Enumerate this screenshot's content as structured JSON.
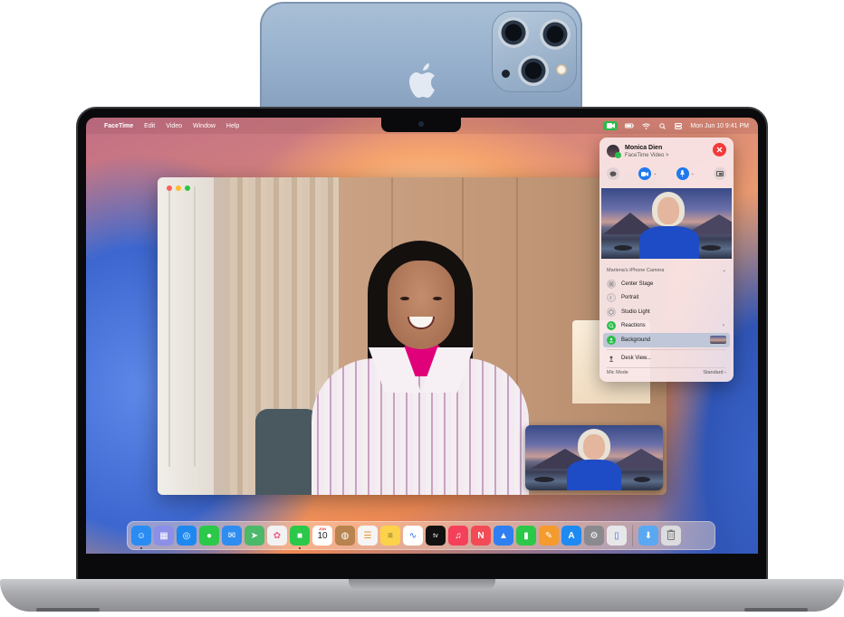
{
  "menubar": {
    "app_name": "FaceTime",
    "menus": [
      "Edit",
      "Video",
      "Window",
      "Help"
    ],
    "datetime": "Mon Jun 10  9:41 PM"
  },
  "control_center": {
    "caller_name": "Monica Dien",
    "caller_subtitle": "FaceTime Video >",
    "camera_section": "Marlena's iPhone Camera",
    "effects": [
      {
        "label": "Center Stage",
        "icon": "center-stage-icon",
        "active": false
      },
      {
        "label": "Portrait",
        "icon": "portrait-icon",
        "active": false
      },
      {
        "label": "Studio Light",
        "icon": "studio-light-icon",
        "active": false
      },
      {
        "label": "Reactions",
        "icon": "reactions-icon",
        "active": true
      },
      {
        "label": "Background",
        "icon": "background-icon",
        "active": true
      }
    ],
    "desk_view": "Desk View...",
    "mic_mode_label": "Mic Mode",
    "mic_mode_value": "Standard"
  },
  "dock": {
    "calendar_month": "JUN",
    "calendar_day": "10",
    "apps": [
      {
        "name": "finder",
        "color": "#2a8cf2",
        "glyph": "☺"
      },
      {
        "name": "launchpad",
        "color": "#8b8fe8",
        "glyph": "▦"
      },
      {
        "name": "safari",
        "color": "#1d88f0",
        "glyph": "◎"
      },
      {
        "name": "messages",
        "color": "#2cc84a",
        "glyph": "●"
      },
      {
        "name": "mail",
        "color": "#2f8cf0",
        "glyph": "✉"
      },
      {
        "name": "maps",
        "color": "#4bb86a",
        "glyph": "➤"
      },
      {
        "name": "photos",
        "color": "#f2f2f2",
        "glyph": "✿"
      },
      {
        "name": "facetime",
        "color": "#2cc84a",
        "glyph": "■"
      }
    ],
    "apps2": [
      {
        "name": "freeform-notes",
        "color": "#b8834f",
        "glyph": "◍"
      },
      {
        "name": "reminders",
        "color": "#f5f5f5",
        "glyph": "☰"
      },
      {
        "name": "notes",
        "color": "#fcd24a",
        "glyph": "≡"
      },
      {
        "name": "freeform",
        "color": "#ffffff",
        "glyph": "∿"
      },
      {
        "name": "apple-tv",
        "color": "#111111",
        "glyph": "tv"
      },
      {
        "name": "music",
        "color": "#f4405a",
        "glyph": "♫"
      },
      {
        "name": "news",
        "color": "#f24b55",
        "glyph": "N"
      },
      {
        "name": "keynote",
        "color": "#2f7ff0",
        "glyph": "▲"
      },
      {
        "name": "numbers",
        "color": "#2cc84a",
        "glyph": "▮"
      },
      {
        "name": "pages",
        "color": "#f59a2c",
        "glyph": "✎"
      },
      {
        "name": "app-store",
        "color": "#1e8af2",
        "glyph": "A"
      },
      {
        "name": "system-settings",
        "color": "#8a8a8e",
        "glyph": "⚙"
      },
      {
        "name": "iphone-mirroring",
        "color": "#e7e7ea",
        "glyph": "▯"
      }
    ],
    "apps3": [
      {
        "name": "downloads",
        "color": "#5aa8f2",
        "glyph": "⬇"
      },
      {
        "name": "trash",
        "color": "#dcdcde",
        "glyph": "🗑"
      }
    ]
  }
}
